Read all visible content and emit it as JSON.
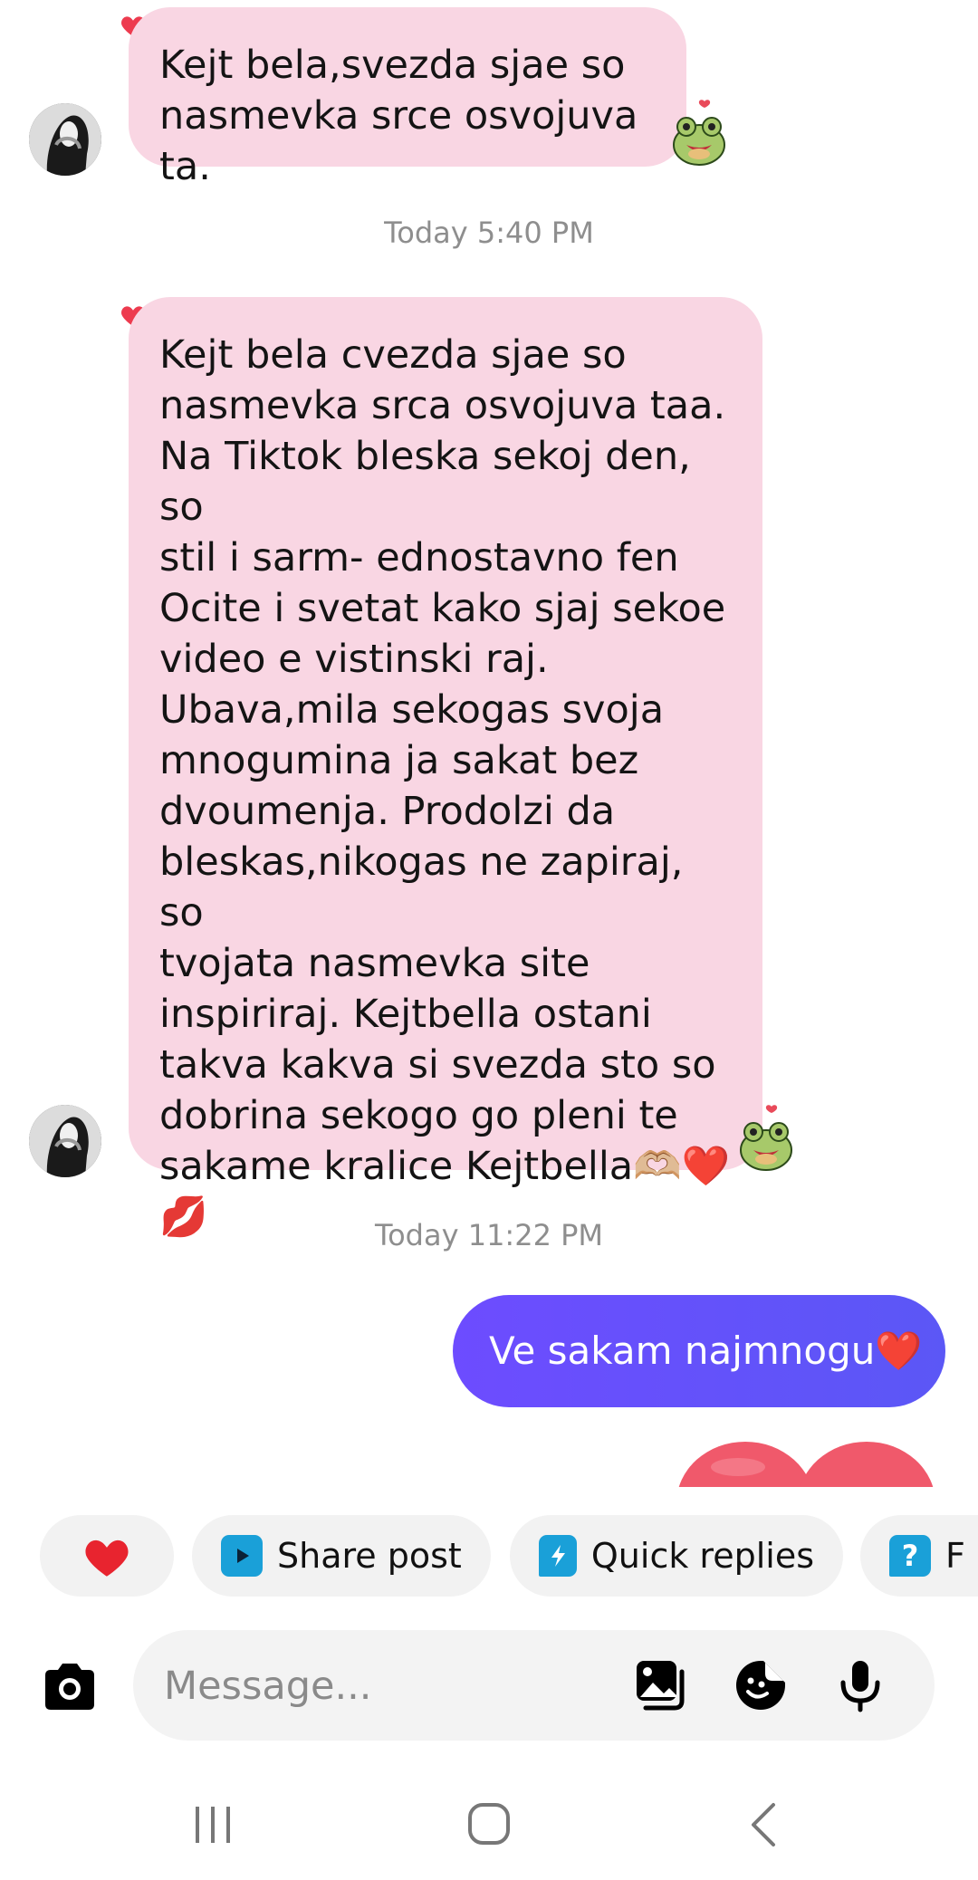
{
  "messages": [
    {
      "sender": "them",
      "text": "Kejt bela,svezda sjae so\nnasmevka srce osvojuva ta.",
      "reaction": "heart"
    },
    {
      "timestamp": "Today 5:40 PM"
    },
    {
      "sender": "them",
      "text": "Kejt bela cvezda sjae so\nnasmevka srca osvojuva taa.\nNa Tiktok bleska sekoj den, so\nstil i sarm- ednostavno fen\nOcite i svetat kako sjaj sekoe\nvideo e vistinski raj.\nUbava,mila sekogas svoja\nmnogumina ja sakat  bez\ndvoumenja.  Prodolzi da\nbleskas,nikogas ne zapiraj,  so\ntvojata nasmevka site\ninspiriraj. Kejtbella ostani\ntakva kakva si svezda sto so\ndobrina sekogo go pleni te\nsakame kralice Kejtbella🫶🏼❤️\n💋",
      "reaction": "heart"
    },
    {
      "timestamp": "Today 11:22 PM"
    },
    {
      "sender": "me",
      "text": "Ve sakam najmnogu❤️"
    }
  ],
  "quick_actions": [
    {
      "label": "",
      "icon": "red-heart-icon"
    },
    {
      "label": "Share post",
      "icon": "play-square-icon"
    },
    {
      "label": "Quick replies",
      "icon": "lightning-chat-icon"
    },
    {
      "label": "F",
      "icon": "question-chat-icon"
    }
  ],
  "composer": {
    "placeholder": "Message...",
    "icons": [
      "camera-icon",
      "gallery-icon",
      "sticker-icon",
      "microphone-icon"
    ]
  },
  "colors": {
    "incoming_bubble": "#f9d6e3",
    "outgoing_bubble": "#6a4fff",
    "timestamp": "#8e8e8e",
    "chip_background": "#f2f2f2"
  }
}
